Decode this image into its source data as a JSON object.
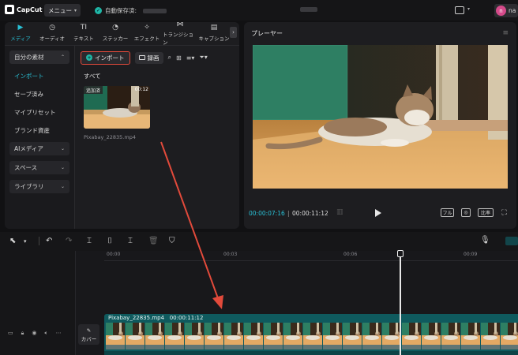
{
  "app": {
    "logo_text": "CapCut",
    "menu_label": "メニュー",
    "autosave_label": "自動保存済:",
    "user_initial": "n",
    "user_name_partial": "na"
  },
  "media_panel": {
    "tabs": [
      {
        "label": "メディア",
        "icon": "media-icon",
        "glyph": "▶",
        "active": true
      },
      {
        "label": "オーディオ",
        "icon": "audio-icon",
        "glyph": "◷",
        "active": false
      },
      {
        "label": "テキスト",
        "icon": "text-icon",
        "glyph": "TI",
        "active": false
      },
      {
        "label": "ステッカー",
        "icon": "sticker-icon",
        "glyph": "◔",
        "active": false
      },
      {
        "label": "エフェクト",
        "icon": "effect-icon",
        "glyph": "✧",
        "active": false
      },
      {
        "label": "トランジション",
        "icon": "transition-icon",
        "glyph": "⋈",
        "active": false
      },
      {
        "label": "キャプション",
        "icon": "caption-icon",
        "glyph": "▤",
        "active": false
      }
    ],
    "sidebar": {
      "local_header": "自分の素材",
      "items": [
        "インポート",
        "セーブ済み",
        "マイプリセット",
        "ブランド資産"
      ],
      "selected_index": 0,
      "groups": [
        "AIメディア",
        "スペース",
        "ライブラリ"
      ]
    },
    "toolbar": {
      "import_label": "インポート",
      "record_label": "録画"
    },
    "section_label": "すべて",
    "media_item": {
      "badge": "追加済",
      "duration": "00:12",
      "filename": "Pixabay_22835.mp4"
    }
  },
  "player": {
    "title": "プレーヤー",
    "current_time": "00:00:07:16",
    "separator": "|",
    "total_time": "00:00:11:12",
    "ratio_label": "フル",
    "aspect_label": "比率"
  },
  "timeline": {
    "ruler_labels": [
      "00:00",
      "00:03",
      "00:06",
      "00:09"
    ],
    "cover_label": "カバー",
    "clip_name": "Pixabay_22835.mp4",
    "clip_duration": "00:00:11:12"
  },
  "colors": {
    "accent": "#29c1d6",
    "annotation_red": "#e24a3b",
    "clip_teal": "#0f5a5e"
  }
}
